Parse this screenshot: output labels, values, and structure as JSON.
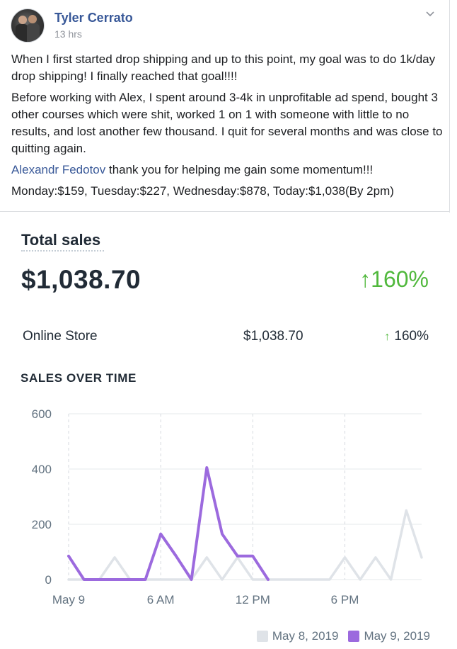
{
  "post": {
    "author": "Tyler Cerrato",
    "time": "13 hrs",
    "paragraph1": "When I first started drop shipping and up to this point, my goal was to do 1k/day drop shipping! I finally reached that goal!!!!",
    "paragraph2": "Before working with Alex, I spent around 3-4k in unprofitable ad spend, bought 3 other courses which were shit, worked 1 on 1 with someone with little to no results, and lost another few thousand. I quit for several months and was close to quitting again.",
    "mention": "Alexandr Fedotov",
    "paragraph3_rest": " thank you for helping me gain some momentum!!!",
    "paragraph4": "Monday:$159, Tuesday:$227, Wednesday:$878, Today:$1,038(By 2pm)",
    "icons": {
      "avatar": "profile-photo",
      "menu": "chevron-down-icon"
    }
  },
  "stats": {
    "title": "Total sales",
    "value": "$1,038.70",
    "change": "160%",
    "change_arrow": "↑",
    "row_label": "Online Store",
    "row_value": "$1,038.70",
    "row_change": "160%",
    "row_arrow": "↑",
    "section_title": "SALES OVER TIME",
    "accent_up": "#50b83c"
  },
  "chart_data": {
    "type": "line",
    "title": "SALES OVER TIME",
    "ylim": [
      0,
      600
    ],
    "yticks": [
      0,
      200,
      400,
      600
    ],
    "xticks": [
      {
        "at": 0,
        "label": "May 9"
      },
      {
        "at": 6,
        "label": "6 AM"
      },
      {
        "at": 12,
        "label": "12 PM"
      },
      {
        "at": 18,
        "label": "6 PM"
      }
    ],
    "x": [
      0,
      1,
      2,
      3,
      4,
      5,
      6,
      7,
      8,
      9,
      10,
      11,
      12,
      13,
      14,
      15,
      16,
      17,
      18,
      19,
      20,
      21,
      22,
      23
    ],
    "series": [
      {
        "name": "May 8, 2019",
        "color": "#dfe3e8",
        "values": [
          0,
          0,
          0,
          80,
          0,
          0,
          0,
          0,
          0,
          80,
          0,
          80,
          0,
          0,
          0,
          0,
          0,
          0,
          80,
          0,
          80,
          0,
          250,
          80
        ]
      },
      {
        "name": "May 9, 2019",
        "color": "#9c6ade",
        "values": [
          85,
          0,
          0,
          0,
          0,
          0,
          165,
          85,
          0,
          405,
          165,
          85,
          85,
          0
        ]
      }
    ],
    "legend": "bottom-right"
  }
}
